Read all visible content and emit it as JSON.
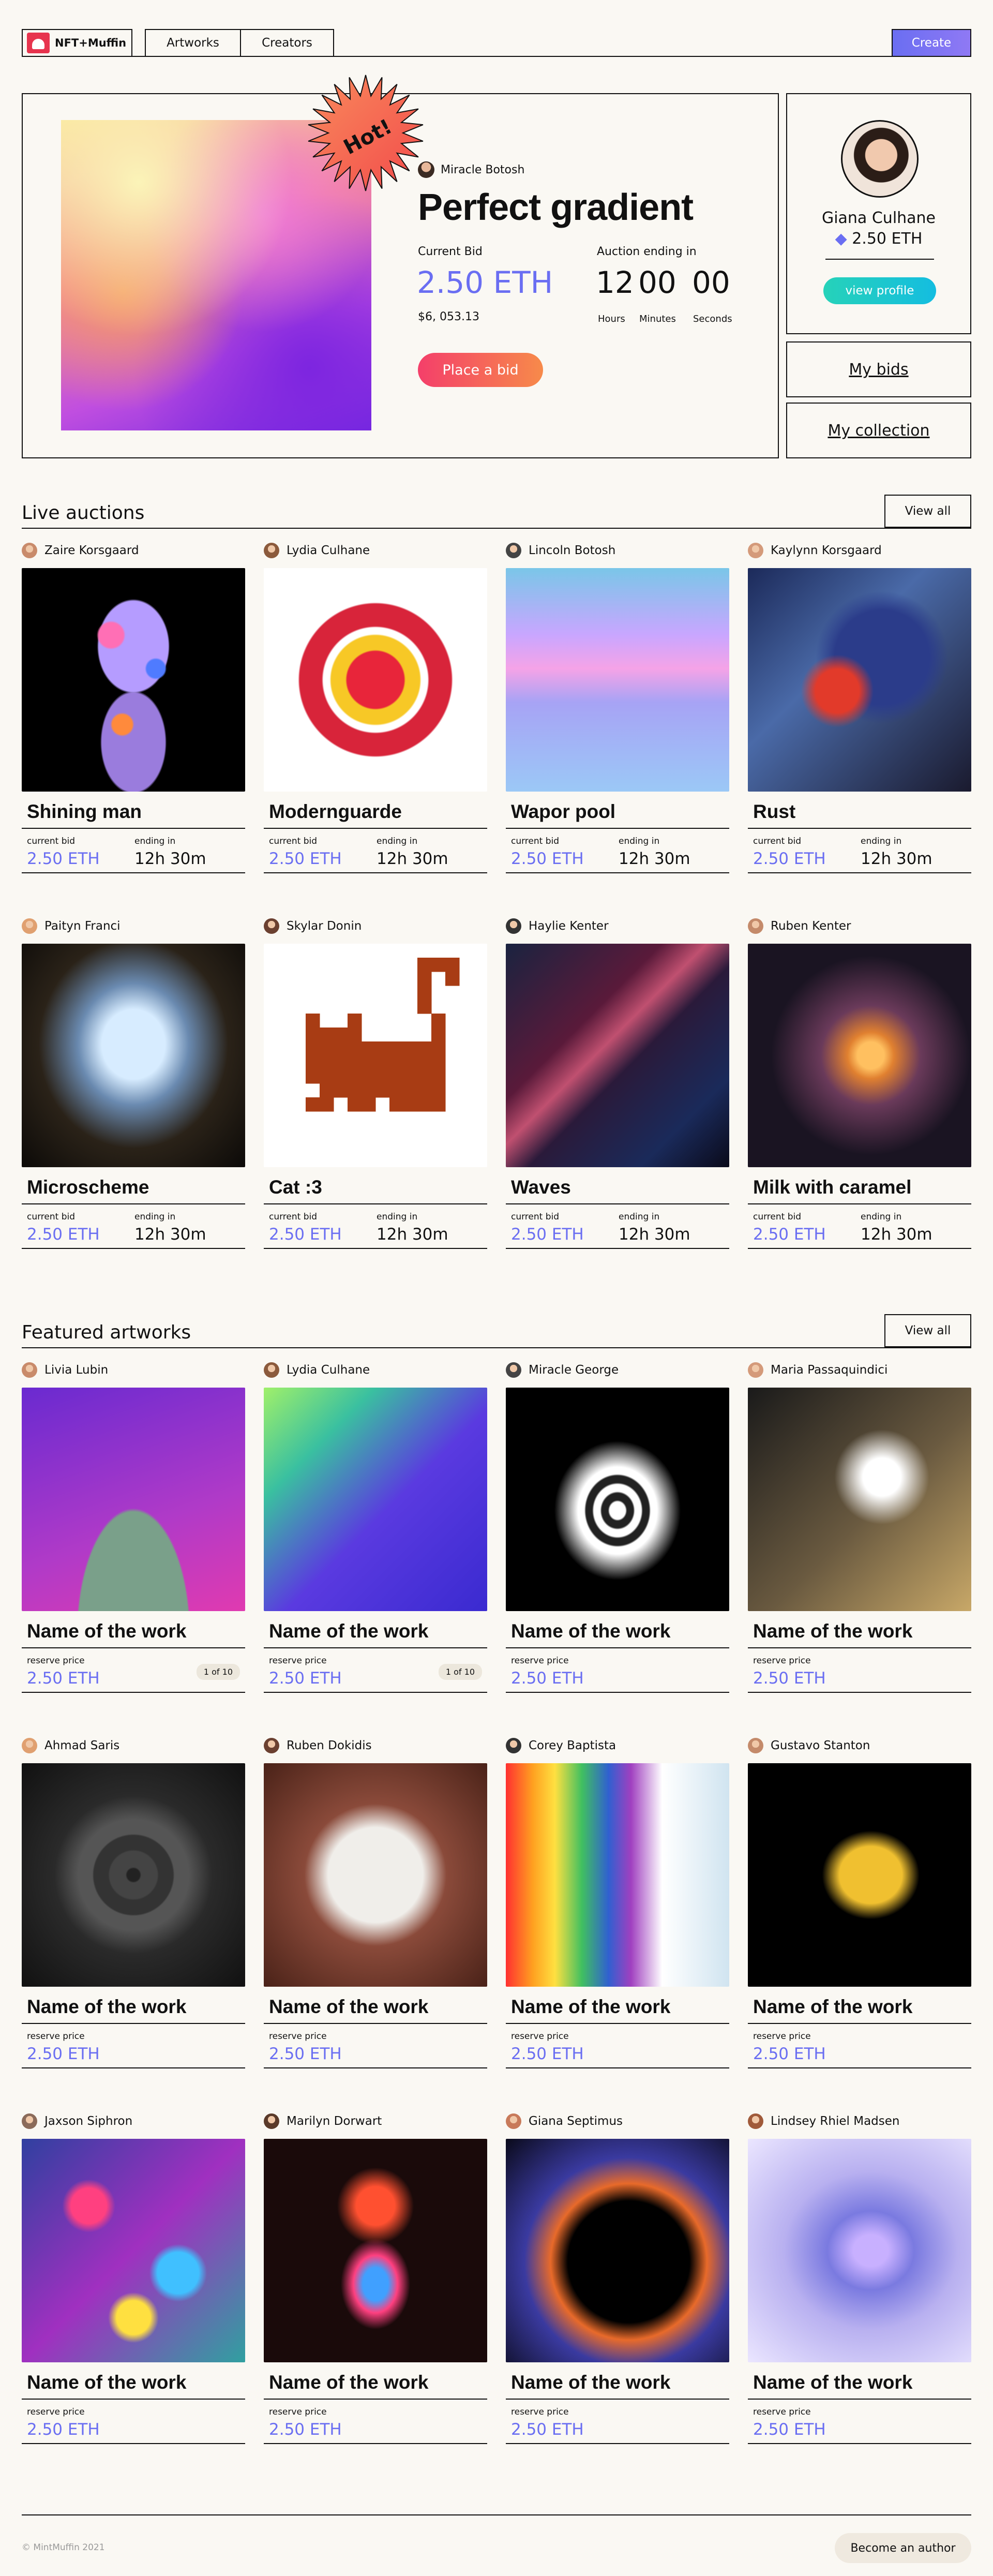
{
  "header": {
    "logo_text": "NFT+Muffin",
    "nav": [
      "Artworks",
      "Creators"
    ],
    "create_label": "Create"
  },
  "hero": {
    "badge": "Hot!",
    "author": "Miracle Botosh",
    "title": "Perfect gradient",
    "current_bid_label": "Current Bid",
    "current_bid": "2.50 ETH",
    "current_bid_usd": "$6, 053.13",
    "auction_label": "Auction ending in",
    "timer": {
      "hours": "12",
      "minutes": "00",
      "seconds": "00"
    },
    "timer_labels": {
      "hours": "Hours",
      "minutes": "Minutes",
      "seconds": "Seconds"
    },
    "bid_button": "Place a bid"
  },
  "profile": {
    "name": "Giana Culhane",
    "eth": "2.50 ETH",
    "view_profile": "view profile",
    "my_bids": "My bids",
    "my_collection": "My collection"
  },
  "live": {
    "title": "Live auctions",
    "view_all": "View all",
    "bid_label": "current bid",
    "ending_label": "ending in",
    "items": [
      {
        "author": "Zaire Korsgaard",
        "name": "Shining man",
        "bid": "2.50 ETH",
        "ending": "12h 30m"
      },
      {
        "author": "Lydia Culhane",
        "name": "Modernguarde",
        "bid": "2.50 ETH",
        "ending": "12h 30m"
      },
      {
        "author": "Lincoln Botosh",
        "name": "Wapor pool",
        "bid": "2.50 ETH",
        "ending": "12h 30m"
      },
      {
        "author": "Kaylynn Korsgaard",
        "name": "Rust",
        "bid": "2.50 ETH",
        "ending": "12h 30m"
      },
      {
        "author": "Paityn Franci",
        "name": "Microscheme",
        "bid": "2.50 ETH",
        "ending": "12h 30m"
      },
      {
        "author": "Skylar Donin",
        "name": "Cat :3",
        "bid": "2.50 ETH",
        "ending": "12h 30m"
      },
      {
        "author": "Haylie Kenter",
        "name": "Waves",
        "bid": "2.50 ETH",
        "ending": "12h 30m"
      },
      {
        "author": "Ruben Kenter",
        "name": "Milk with caramel",
        "bid": "2.50 ETH",
        "ending": "12h 30m"
      }
    ]
  },
  "featured": {
    "title": "Featured artworks",
    "view_all": "View all",
    "price_label": "reserve price",
    "items": [
      {
        "author": "Livia Lubin",
        "name": "Name of the work",
        "price": "2.50 ETH",
        "edition": "1 of 10"
      },
      {
        "author": "Lydia Culhane",
        "name": "Name of the work",
        "price": "2.50 ETH",
        "edition": "1 of 10"
      },
      {
        "author": "Miracle George",
        "name": "Name of the work",
        "price": "2.50 ETH"
      },
      {
        "author": "Maria Passaquindici",
        "name": "Name of the work",
        "price": "2.50 ETH"
      },
      {
        "author": "Ahmad Saris",
        "name": "Name of the work",
        "price": "2.50 ETH"
      },
      {
        "author": "Ruben Dokidis",
        "name": "Name of the work",
        "price": "2.50 ETH"
      },
      {
        "author": "Corey Baptista",
        "name": "Name of the work",
        "price": "2.50 ETH"
      },
      {
        "author": "Gustavo Stanton",
        "name": "Name of the work",
        "price": "2.50 ETH"
      },
      {
        "author": "Jaxson Siphron",
        "name": "Name of the work",
        "price": "2.50 ETH"
      },
      {
        "author": "Marilyn Dorwart",
        "name": "Name of the work",
        "price": "2.50 ETH"
      },
      {
        "author": "Giana Septimus",
        "name": "Name of the work",
        "price": "2.50 ETH"
      },
      {
        "author": "Lindsey Rhiel Madsen",
        "name": "Name of the work",
        "price": "2.50 ETH"
      }
    ]
  },
  "footer": {
    "copyright": "© MintMuffin 2021",
    "author_button": "Become an author"
  }
}
